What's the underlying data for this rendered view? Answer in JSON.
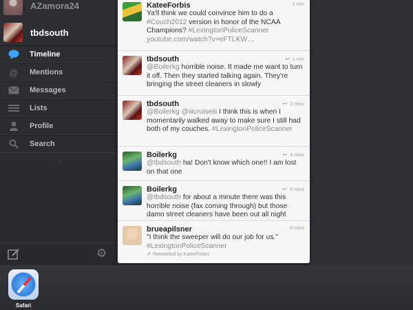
{
  "sidebar": {
    "accounts": [
      {
        "name": "AZamora24"
      },
      {
        "name": "tbdsouth"
      }
    ],
    "items": [
      {
        "label": "Timeline",
        "icon": "speech-bubble-icon"
      },
      {
        "label": "Mentions",
        "icon": "at-icon"
      },
      {
        "label": "Messages",
        "icon": "envelope-icon"
      },
      {
        "label": "Lists",
        "icon": "list-icon"
      },
      {
        "label": "Profile",
        "icon": "person-icon"
      },
      {
        "label": "Search",
        "icon": "search-icon"
      }
    ],
    "active": "Timeline"
  },
  "tweets": [
    {
      "user": "KateeForbis",
      "time": "1 min",
      "retweet_icon": false,
      "text": [
        {
          "t": "Ya'll think we could convince him to do a "
        },
        {
          "t": "#Couch2012",
          "cls": "h"
        },
        {
          "t": " version in honor of the NCAA Champions? "
        },
        {
          "t": "#LexingtonPoliceScanner",
          "cls": "h"
        },
        {
          "t": " "
        },
        {
          "t": "youtube.com/watch?v=eFTLKW…",
          "cls": "h"
        }
      ]
    },
    {
      "user": "tbdsouth",
      "time": "1 min",
      "retweet_icon": true,
      "text": [
        {
          "t": "@Boilerkg",
          "cls": "m"
        },
        {
          "t": " horrible noise. It made me want to turn it off. Then they started talking again. They're bringing the street cleaners in slowly"
        }
      ]
    },
    {
      "user": "tbdsouth",
      "time": "2 mins",
      "retweet_icon": true,
      "text": [
        {
          "t": "@Boilerkg",
          "cls": "m"
        },
        {
          "t": " "
        },
        {
          "t": "@iiicruiseiii",
          "cls": "m"
        },
        {
          "t": " I think this is when I momentarily walked away to make sure I still had both of my couches. "
        },
        {
          "t": "#LexingtonPoliceScanner",
          "cls": "h"
        }
      ]
    },
    {
      "user": "Boilerkg",
      "time": "4 mins",
      "retweet_icon": true,
      "text": [
        {
          "t": "@tbdsouth",
          "cls": "m"
        },
        {
          "t": " ha! Don't know which one!! I am lost on that one"
        }
      ]
    },
    {
      "user": "Boilerkg",
      "time": "5 mins",
      "retweet_icon": true,
      "text": [
        {
          "t": "@tbdsouth",
          "cls": "m"
        },
        {
          "t": " for about a minute there was this horrible noise (fax coming through) but those damn street cleaners have been out all night"
        }
      ]
    },
    {
      "user": "brueapilsner",
      "time": "6 mins",
      "retweet_icon": false,
      "text": [
        {
          "t": "\"I think the sweeper will do our job for us.\" "
        },
        {
          "t": "#LexingtonPoliceScanner",
          "cls": "h"
        }
      ],
      "retweeted_by": "Retweeted by KateeForbis"
    }
  ],
  "dock": {
    "app_label": "Safari"
  }
}
